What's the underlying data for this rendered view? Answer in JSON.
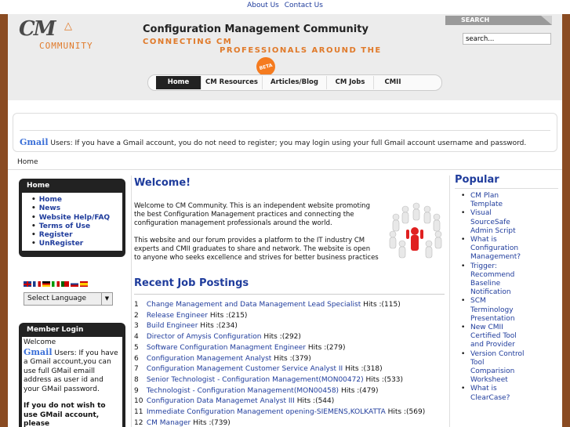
{
  "top_links": [
    "About Us",
    "Contact Us"
  ],
  "header": {
    "logo_text": "CM",
    "logo_sub": "COMMUNITY",
    "site_title": "Configuration Management Community",
    "tagline_1": "CONNECTING CM",
    "tagline_2": "PROFESSIONALS AROUND THE",
    "beta_badge": "BETA",
    "search_label": "SEARCH",
    "search_value": "search..."
  },
  "nav": {
    "items": [
      {
        "label": "Home",
        "active": true
      },
      {
        "label": "CM Resources",
        "active": false
      },
      {
        "label": "Articles/Blog",
        "active": false
      },
      {
        "label": "CM Jobs",
        "active": false
      },
      {
        "label": "CMII",
        "active": false
      }
    ]
  },
  "notice": {
    "logo": "Gmail",
    "text": "Users: If you have a Gmail account, you do not need to register; you may login using your full Gmail account username and password."
  },
  "breadcrumb": "Home",
  "sidebar": {
    "home_box": {
      "title": "Home",
      "items": [
        "Home",
        "News",
        "Website Help/FAQ",
        "Terms of Use",
        "Register",
        "UnRegister"
      ]
    },
    "language": {
      "selected": "Select Language"
    },
    "member_box": {
      "title": "Member Login",
      "welcome": "Welcome",
      "gmail_logo": "Gmail",
      "text": "Users: If you have a Gmail account,you can use full GMail emaill address as user id and your GMail password.",
      "bold_text": "If you do not wish to use GMail account, please"
    }
  },
  "main": {
    "welcome_title": "Welcome!",
    "welcome_p1": "Welcome to CM Community. This is an independent website promoting the best Configuration Management practices and connecting the configuration management professionals around the world.",
    "welcome_p2": "This website and our forum provides a platform to the IT industry CM experts and CMII graduates to share and network. The website is open to anyone who seeks excellence and strives for better business practices",
    "jobs_title": "Recent Job Postings",
    "jobs": [
      {
        "n": "1",
        "title": "Change Management and Data Management Lead Specialist",
        "hits": "Hits :(115)"
      },
      {
        "n": "2",
        "title": "Release Engineer",
        "hits": "Hits :(215)"
      },
      {
        "n": "3",
        "title": "Build Engineer",
        "hits": "Hits :(234)"
      },
      {
        "n": "4",
        "title": "Director of Amysis Configuration",
        "hits": "Hits :(292)"
      },
      {
        "n": "5",
        "title": "Software Configuration Managment Engineer",
        "hits": "Hits :(279)"
      },
      {
        "n": "6",
        "title": "Configuration Management Analyst",
        "hits": "Hits :(379)"
      },
      {
        "n": "7",
        "title": "Configuration Management Customer Service Analyst II",
        "hits": "Hits :(318)"
      },
      {
        "n": "8",
        "title": "Senior Technologist - Configuration Management(MON00472)",
        "hits": "Hits :(533)"
      },
      {
        "n": "9",
        "title": "Technologist - Configuration Management(MON00458)",
        "hits": "Hits :(479)"
      },
      {
        "n": "10",
        "title": "Configuration Data Managemet Analyst III",
        "hits": "Hits :(544)"
      },
      {
        "n": "11",
        "title": "Immediate Configuration Management opening-SIEMENS,KOLKATTA",
        "hits": "Hits :(569)"
      },
      {
        "n": "12",
        "title": "CM Manager",
        "hits": "Hits :(739)"
      }
    ]
  },
  "popular": {
    "title": "Popular",
    "items": [
      "CM Plan Template",
      "Visual SourceSafe Admin Script",
      "What is Configuration Management?",
      "Trigger: Recommend Baseline Notification",
      "SCM Terminology Presentation",
      "New CMII Certified Tool and Provider",
      "Version Control Tool Comparision Worksheet",
      "What is ClearCase?"
    ]
  }
}
